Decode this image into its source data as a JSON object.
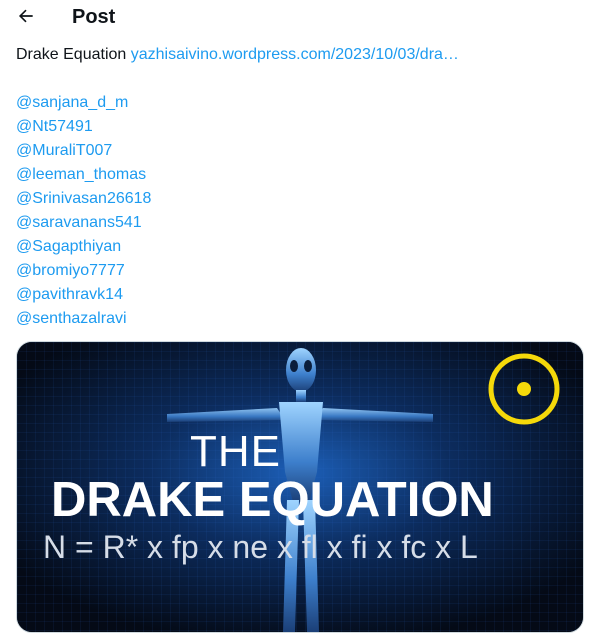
{
  "header": {
    "back_icon": "arrow-left-icon",
    "title": "Post"
  },
  "post": {
    "intro_text": "Drake Equation",
    "link_text": "yazhisaivino.wordpress.com/2023/10/03/dra…",
    "mentions": [
      "@sanjana_d_m",
      "@Nt57491",
      "@MuraliT007",
      "@leeman_thomas",
      "@Srinivasan26618",
      "@saravanans541",
      "@Sagapthiyan",
      "@bromiyo7777",
      "@pavithravk14",
      "@senthazalravi"
    ]
  },
  "media": {
    "title_line1": "THE",
    "title_line2": "DRAKE EQUATION",
    "formula": "N = R* x fp x ne x fl x fi x fc x L",
    "badge_icon": "circled-dot-icon"
  },
  "colors": {
    "link": "#1d9bf0",
    "text": "#0f1419",
    "badge": "#f5d90a"
  }
}
